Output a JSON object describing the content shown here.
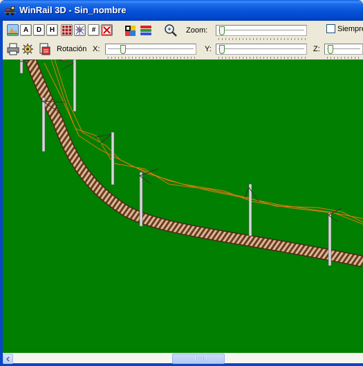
{
  "window": {
    "title": "WinRail 3D - Sin_nombre",
    "icon": "locomotive-icon"
  },
  "toolbar_top": {
    "buttons": [
      {
        "name": "view-angle-button",
        "icon": "mountain-icon",
        "selected": true
      },
      {
        "name": "view-a-button",
        "label": "A"
      },
      {
        "name": "view-d-button",
        "label": "D"
      },
      {
        "name": "view-h-button",
        "label": "H"
      },
      {
        "name": "track-grid-button",
        "icon": "grid-icon"
      },
      {
        "name": "wireframe-button",
        "icon": "wireframe-icon"
      },
      {
        "name": "hash-button",
        "label": "#"
      },
      {
        "name": "catenary-button",
        "icon": "catenary-icon"
      },
      {
        "name": "color-palette-button",
        "icon": "palette-icon"
      },
      {
        "name": "layers-button",
        "icon": "layers-icon"
      },
      {
        "name": "zoom-button",
        "icon": "magnifier-icon"
      }
    ],
    "zoom_label": "Zoom:",
    "zoom_value": 0.0,
    "always_label": "Siempre"
  },
  "toolbar_bottom": {
    "rotation_label": "Rotación",
    "x_label": "X:",
    "y_label": "Y:",
    "z_label": "Z:",
    "x_value": 0.15,
    "y_value": 0.0,
    "z_value": 0.0
  },
  "colors": {
    "ground": "#007F00",
    "track_light": "#D9B893",
    "track_dark": "#6B3B22",
    "pole": "#E6E6E6",
    "wire": "#E07A10",
    "titlebar": "#0852D8"
  }
}
